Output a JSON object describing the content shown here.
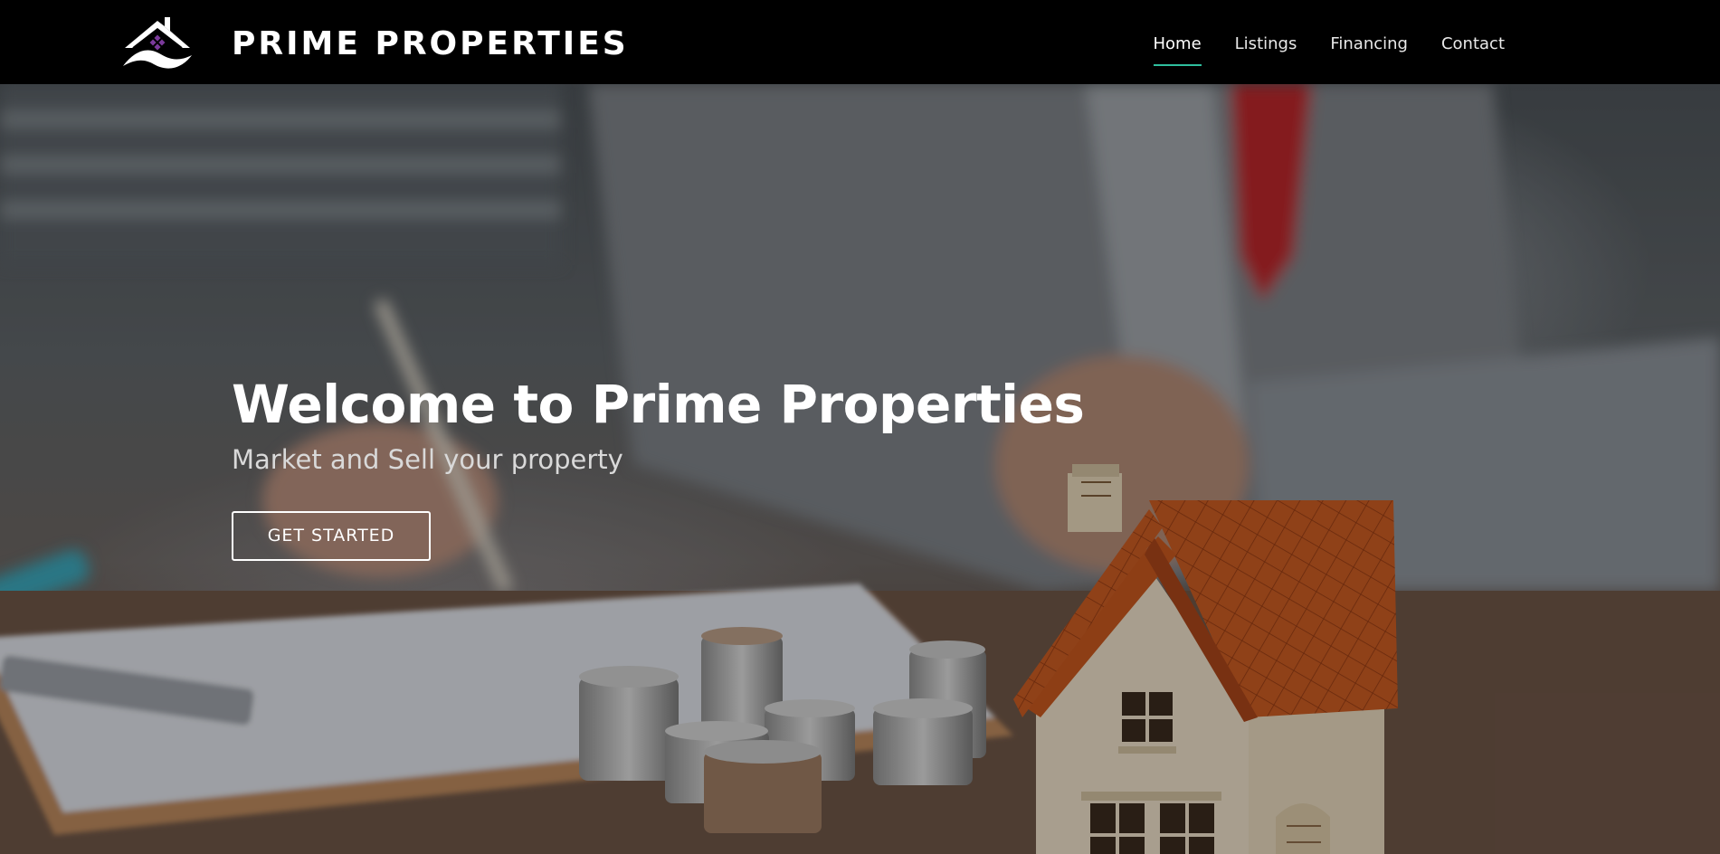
{
  "brand": {
    "name": "PRIME PROPERTIES",
    "logo_icon": "house-roof-logo-icon"
  },
  "nav": {
    "items": [
      {
        "label": "Home",
        "active": true
      },
      {
        "label": "Listings",
        "active": false
      },
      {
        "label": "Financing",
        "active": false
      },
      {
        "label": "Contact",
        "active": false
      }
    ],
    "active_underline_color": "#2fbf9e"
  },
  "hero": {
    "title": "Welcome to Prime Properties",
    "subtitle": "Market and Sell your property",
    "cta_label": "GET STARTED",
    "background_image": "agent-signing-contract-with-model-house-and-coins"
  },
  "colors": {
    "header_bg": "#000000",
    "text": "#ffffff",
    "roof": "#c4561e"
  }
}
